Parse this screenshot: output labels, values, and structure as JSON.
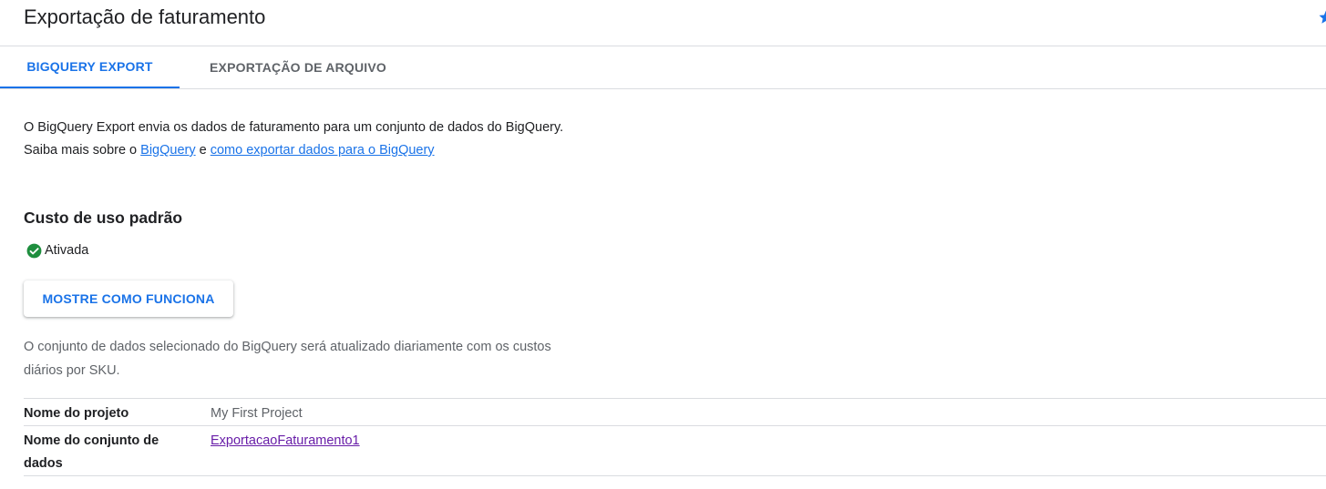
{
  "header": {
    "title": "Exportação de faturamento"
  },
  "tabs": [
    {
      "label": "BIGQUERY EXPORT",
      "active": true
    },
    {
      "label": "EXPORTAÇÃO DE ARQUIVO",
      "active": false
    }
  ],
  "intro": {
    "text_1": "O BigQuery Export envia os dados de faturamento para um conjunto de dados do BigQuery. Saiba mais sobre o ",
    "link_1": "BigQuery",
    "text_2": " e ",
    "link_2": "como exportar dados para o BigQuery"
  },
  "section": {
    "title": "Custo de uso padrão",
    "status_label": "Ativada",
    "status_icon": "check-circle-icon",
    "status_color": "#1e8e3e",
    "button_label": "MOSTRE COMO FUNCIONA",
    "description": "O conjunto de dados selecionado do BigQuery será atualizado diariamente com os custos diários por SKU."
  },
  "details": {
    "rows": [
      {
        "label": "Nome do projeto",
        "value": "My First Project"
      },
      {
        "label": "Nome do conjunto de dados",
        "value": "ExportacaoFaturamento1"
      }
    ]
  },
  "colors": {
    "accent": "#1a73e8",
    "visited_link": "#681da8",
    "success": "#1e8e3e"
  }
}
